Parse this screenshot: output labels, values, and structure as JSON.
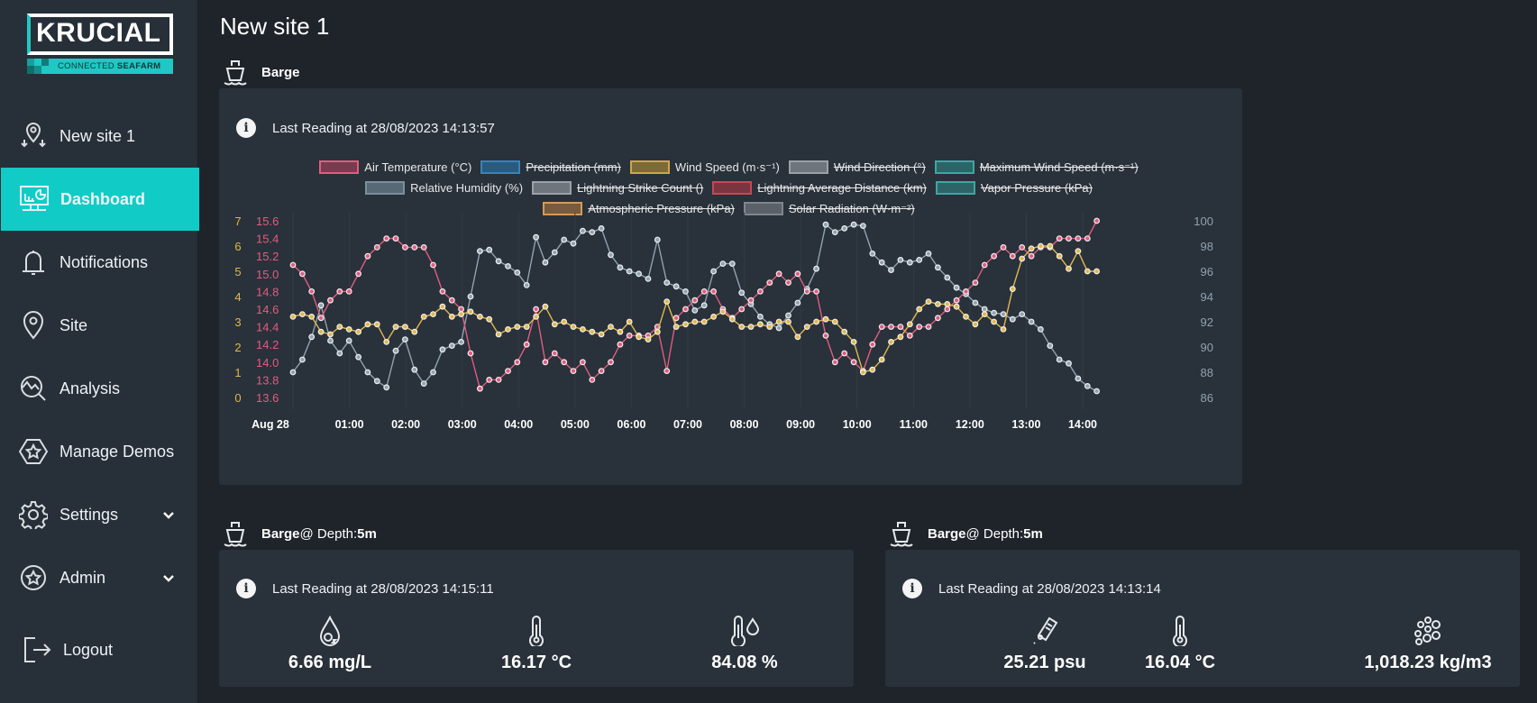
{
  "brand": {
    "name": "KRUCIAL",
    "tagline_light": "CONNECTED",
    "tagline_bold": "SEAFARM",
    "accent_color": "#11ccc6"
  },
  "sidebar": {
    "items": [
      {
        "label": "New site 1",
        "icon": "location-pin-arrows-icon",
        "active": false
      },
      {
        "label": "Dashboard",
        "icon": "dashboard-monitor-icon",
        "active": true
      },
      {
        "label": "Notifications",
        "icon": "bell-icon",
        "active": false
      },
      {
        "label": "Site",
        "icon": "location-pin-icon",
        "active": false
      },
      {
        "label": "Analysis",
        "icon": "analysis-magnifier-icon",
        "active": false
      },
      {
        "label": "Manage Demos",
        "icon": "hexagon-star-icon",
        "active": false
      },
      {
        "label": "Settings",
        "icon": "gear-icon",
        "active": false,
        "expandable": true
      },
      {
        "label": "Admin",
        "icon": "circle-star-icon",
        "active": false,
        "expandable": true
      },
      {
        "label": "Logout",
        "icon": "logout-icon",
        "active": false
      }
    ]
  },
  "page": {
    "title": "New site 1"
  },
  "barge_panel": {
    "title": "Barge",
    "last_reading": "Last Reading at 28/08/2023 14:13:57"
  },
  "depth_panel_left": {
    "title": "Barge",
    "depth_label": "@ Depth: ",
    "depth_value": "5m",
    "last_reading": "Last Reading at 28/08/2023 14:15:11",
    "metrics": [
      {
        "icon": "oxygen-drop-icon",
        "value": "6.66 mg/L"
      },
      {
        "icon": "thermometer-icon",
        "value": "16.17 °C"
      },
      {
        "icon": "thermometer-drop-icon",
        "value": "84.08 %"
      }
    ]
  },
  "depth_panel_right": {
    "title": "Barge",
    "depth_label": "@ Depth: ",
    "depth_value": "5m",
    "last_reading": "Last Reading at 28/08/2023 14:13:14",
    "metrics": [
      {
        "icon": "salinity-meter-icon",
        "value": "25.21 psu"
      },
      {
        "icon": "thermometer-icon",
        "value": "16.04 °C"
      },
      {
        "icon": "density-bubbles-icon",
        "value": "1,018.23 kg/m3"
      }
    ]
  },
  "chart_data": {
    "type": "line",
    "title": "",
    "xlabel": "",
    "x_tick_labels": [
      "Aug 28",
      "01:00",
      "02:00",
      "03:00",
      "04:00",
      "05:00",
      "06:00",
      "07:00",
      "08:00",
      "09:00",
      "10:00",
      "11:00",
      "12:00",
      "13:00",
      "14:00"
    ],
    "x_range_hours": [
      0,
      14.25
    ],
    "x_step_minutes": 15,
    "legend": [
      {
        "name": "Air Temperature (°C)",
        "color": "#e05d80",
        "fill": "#7a3a4f",
        "hidden": false
      },
      {
        "name": "Precipitation (mm)",
        "color": "#3a82b8",
        "fill": "#2a5a7e",
        "hidden": true
      },
      {
        "name": "Wind Speed (m·s⁻¹)",
        "color": "#c9a74c",
        "fill": "#7c6a3a",
        "hidden": false
      },
      {
        "name": "Wind Direction (°)",
        "color": "#9aa1a8",
        "fill": "#6e757c",
        "hidden": true
      },
      {
        "name": "Maximum Wind Speed (m·s⁻¹)",
        "color": "#3fa6a3",
        "fill": "#2d6467",
        "hidden": true
      },
      {
        "name": "Relative Humidity (%)",
        "color": "#7a8f9c",
        "fill": "#566974",
        "hidden": false
      },
      {
        "name": "Lightning Strike Count ()",
        "color": "#9aa1a8",
        "fill": "#6e757c",
        "hidden": true
      },
      {
        "name": "Lightning Average Distance (km)",
        "color": "#c84758",
        "fill": "#7a3540",
        "hidden": true
      },
      {
        "name": "Vapor Pressure (kPa)",
        "color": "#3fa6a3",
        "fill": "#2d6467",
        "hidden": true
      },
      {
        "name": "Atmospheric Pressure (kPa)",
        "color": "#d49a5a",
        "fill": "#7a5a3a",
        "hidden": true
      },
      {
        "name": "Solar Radiation (W·m⁻²)",
        "color": "#7e8790",
        "fill": "#5a6168",
        "hidden": true
      }
    ],
    "axes": {
      "temperature": {
        "side": "left-inner",
        "range": [
          13.6,
          15.6
        ],
        "ticks": [
          "13.6",
          "13.8",
          "14.0",
          "14.2",
          "14.4",
          "14.6",
          "14.8",
          "15.0",
          "15.2",
          "15.4",
          "15.6"
        ],
        "color": "#e05d80"
      },
      "wind": {
        "side": "left-outer",
        "range": [
          0,
          7
        ],
        "ticks": [
          "0",
          "1",
          "2",
          "3",
          "4",
          "5",
          "6",
          "7"
        ],
        "color": "#e0b84e"
      },
      "humidity": {
        "side": "right",
        "range": [
          86,
          100
        ],
        "ticks": [
          "86",
          "88",
          "90",
          "92",
          "94",
          "96",
          "98",
          "100"
        ],
        "color": "#8fa3b0"
      }
    },
    "series": [
      {
        "name": "Air Temperature (°C)",
        "axis": "temperature",
        "color": "#e05d80",
        "values": [
          15.1,
          15.0,
          14.8,
          14.5,
          14.7,
          14.8,
          14.8,
          15.0,
          15.2,
          15.3,
          15.4,
          15.4,
          15.3,
          15.3,
          15.3,
          15.1,
          14.8,
          14.7,
          14.6,
          14.1,
          13.7,
          13.8,
          13.8,
          13.9,
          14.0,
          14.2,
          14.6,
          14.0,
          14.1,
          14.0,
          13.9,
          14.0,
          13.8,
          13.9,
          14.0,
          14.2,
          14.3,
          14.3,
          14.3,
          14.4,
          13.9,
          14.5,
          14.6,
          14.7,
          14.8,
          14.8,
          14.6,
          14.5,
          14.6,
          14.7,
          14.8,
          14.9,
          15.0,
          14.9,
          15.0,
          14.8,
          14.8,
          14.3,
          14.0,
          14.1,
          14.0,
          13.9,
          14.2,
          14.4,
          14.4,
          14.4,
          14.3,
          14.4,
          14.4,
          14.5,
          14.6,
          14.7,
          14.8,
          14.9,
          15.1,
          15.2,
          15.3,
          15.2,
          15.3,
          15.2,
          15.3,
          15.3,
          15.4,
          15.4,
          15.4,
          15.4,
          15.6
        ]
      },
      {
        "name": "Wind Speed (m·s⁻¹)",
        "axis": "wind",
        "color": "#e0b84e",
        "values": [
          3.2,
          3.3,
          3.2,
          2.6,
          2.5,
          2.8,
          2.7,
          2.6,
          2.9,
          2.9,
          2.2,
          2.8,
          2.8,
          2.6,
          3.2,
          3.3,
          3.6,
          3.2,
          3.3,
          3.4,
          3.2,
          3.1,
          2.5,
          2.7,
          2.8,
          2.8,
          3.2,
          3.6,
          2.9,
          3.0,
          2.8,
          2.7,
          2.6,
          2.5,
          2.8,
          2.6,
          3.0,
          2.4,
          2.3,
          2.6,
          3.8,
          2.8,
          2.9,
          3.0,
          3.0,
          3.2,
          3.4,
          3.1,
          2.8,
          2.8,
          2.9,
          2.8,
          3.0,
          3.0,
          2.4,
          2.8,
          3.0,
          3.1,
          3.0,
          2.6,
          2.2,
          1.0,
          1.1,
          1.5,
          2.2,
          2.4,
          2.9,
          3.5,
          3.8,
          3.7,
          3.7,
          3.6,
          3.2,
          2.9,
          3.3,
          3.0,
          2.7,
          4.3,
          5.5,
          5.9,
          6.0,
          6.0,
          5.6,
          5.1,
          5.8,
          5.0,
          5.0
        ]
      },
      {
        "name": "Relative Humidity (%)",
        "axis": "humidity",
        "color": "#8fa3b0",
        "values": [
          88.0,
          89.0,
          90.8,
          93.3,
          90.5,
          89.5,
          90.5,
          89.2,
          88.0,
          87.3,
          86.8,
          89.7,
          90.6,
          88.2,
          87.1,
          88.0,
          89.8,
          90.1,
          90.4,
          94.0,
          97.6,
          97.7,
          96.8,
          96.4,
          95.9,
          94.9,
          98.7,
          96.7,
          97.5,
          98.5,
          98.2,
          99.2,
          99.1,
          99.4,
          97.3,
          96.3,
          96.0,
          95.8,
          95.4,
          98.5,
          95.1,
          94.8,
          94.4,
          92.9,
          93.3,
          96.0,
          96.6,
          96.6,
          94.3,
          93.4,
          92.4,
          91.8,
          91.5,
          92.5,
          93.5,
          94.6,
          96.2,
          99.7,
          99.1,
          99.4,
          99.7,
          99.6,
          97.4,
          96.7,
          96.1,
          96.9,
          96.7,
          96.9,
          97.4,
          96.3,
          95.5,
          94.7,
          94.2,
          93.5,
          93.0,
          92.7,
          92.6,
          92.2,
          92.6,
          92.0,
          91.4,
          90.1,
          89.0,
          88.7,
          87.5,
          86.9,
          86.5
        ]
      }
    ]
  }
}
